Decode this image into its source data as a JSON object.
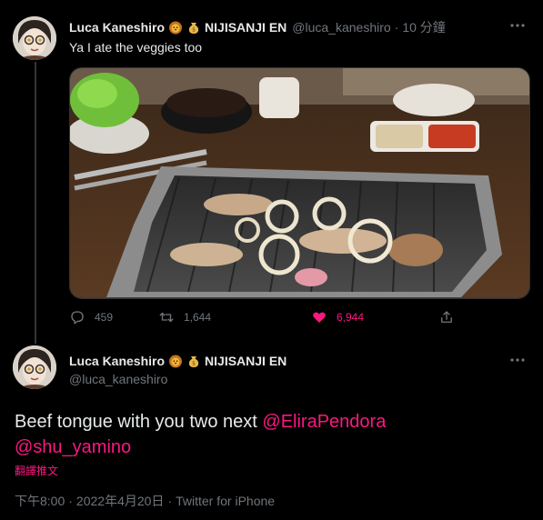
{
  "tweet1": {
    "display_name": "Luca Kaneshiro",
    "name_suffix": "NIJISANJI EN",
    "handle": "@luca_kaneshiro",
    "separator": "·",
    "time": "10 分鐘",
    "text": "Ya I ate the veggies too",
    "stats": {
      "replies": "459",
      "retweets": "1,644",
      "likes": "6,944"
    },
    "like_color": "#f91880"
  },
  "tweet2": {
    "display_name": "Luca Kaneshiro",
    "name_suffix": "NIJISANJI EN",
    "handle": "@luca_kaneshiro",
    "text_prefix": "Beef tongue with you two next ",
    "mention1": "@EliraPendora",
    "mention2": "@shu_yamino",
    "translate": "翻譯推文",
    "time": "下午8:00",
    "separator1": "·",
    "date": "2022年4月20日",
    "separator2": "·",
    "source": "Twitter for iPhone"
  },
  "icons": {
    "lion_emoji": "lion-emoji",
    "money_bag_emoji": "money-bag-emoji",
    "more": "more-dots-icon",
    "reply": "reply-icon",
    "retweet": "retweet-icon",
    "like": "heart-icon",
    "share": "share-icon"
  },
  "colors": {
    "background": "#000000",
    "text": "#e7e9ea",
    "muted": "#71767b",
    "accent": "#f91880"
  }
}
